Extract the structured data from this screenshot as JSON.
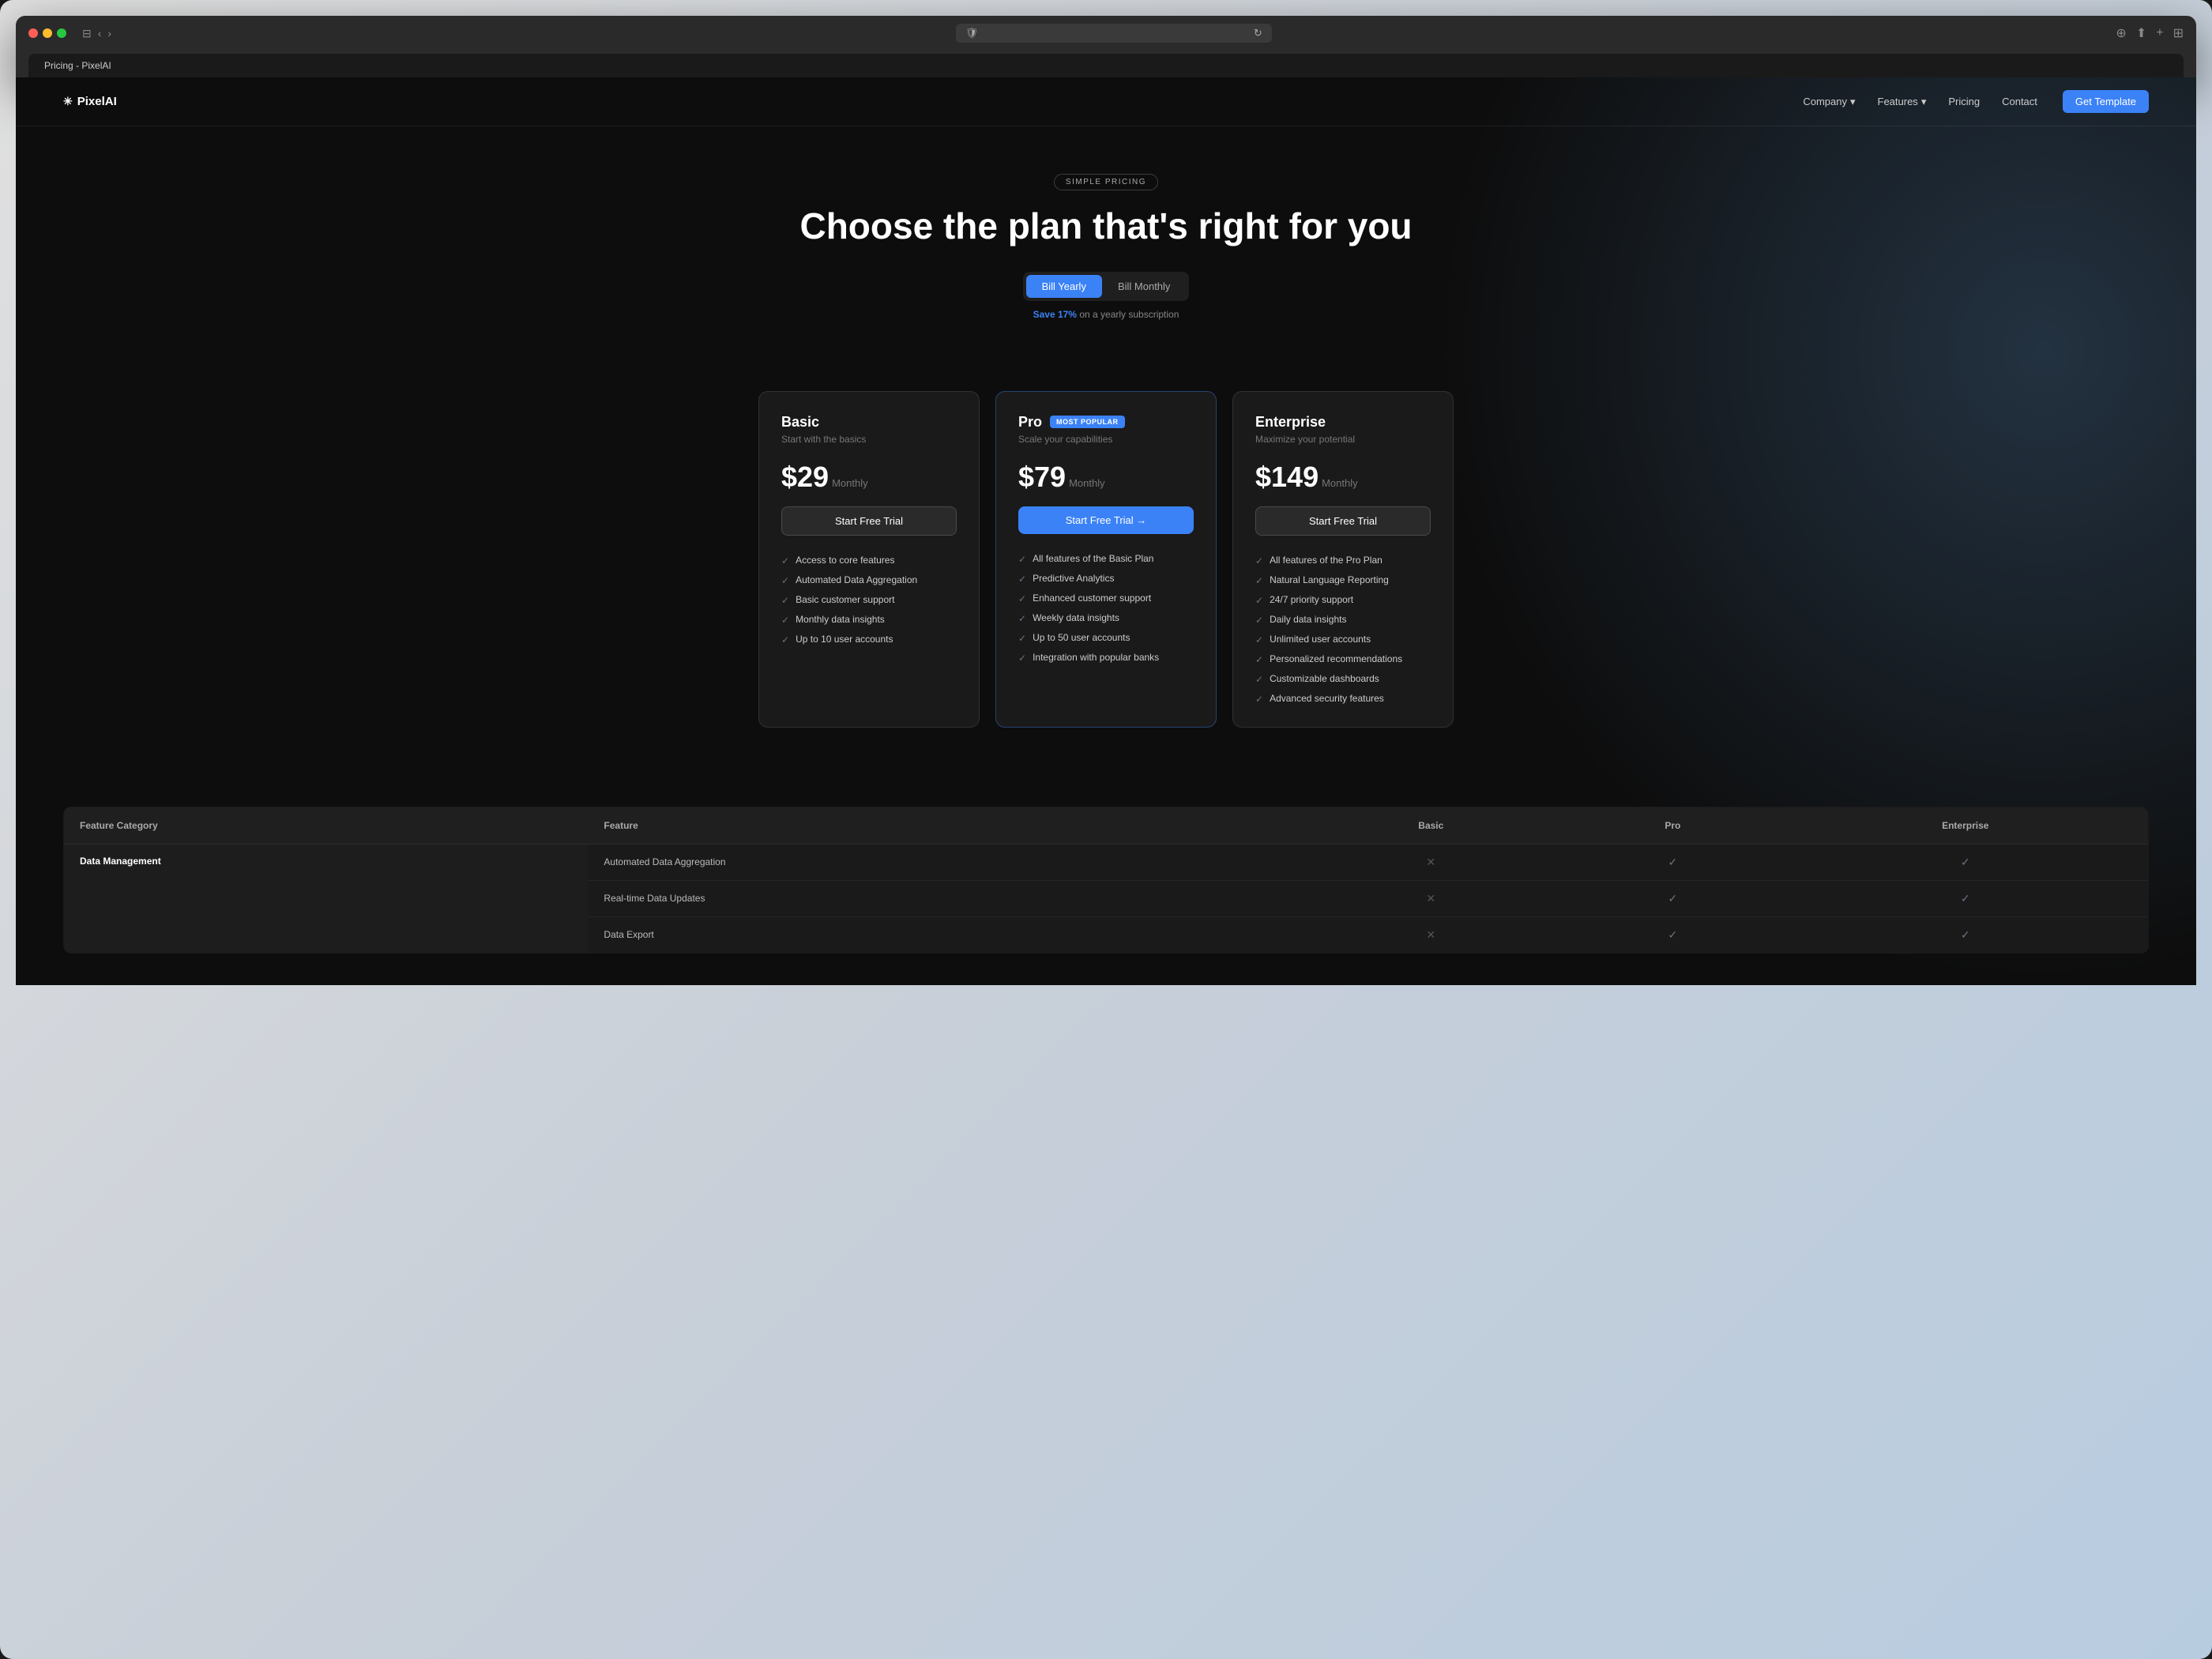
{
  "browser": {
    "tab_title": "Pricing - PixelAI"
  },
  "nav": {
    "logo": "PixelAI",
    "logo_icon": "✳",
    "links": [
      {
        "label": "Company",
        "has_dropdown": true
      },
      {
        "label": "Features",
        "has_dropdown": true
      },
      {
        "label": "Pricing",
        "has_dropdown": false
      },
      {
        "label": "Contact",
        "has_dropdown": false
      }
    ],
    "cta_label": "Get Template"
  },
  "hero": {
    "badge": "SIMPLE PRICING",
    "title": "Choose the plan that's right for you",
    "billing_yearly_label": "Bill Yearly",
    "billing_monthly_label": "Bill Monthly",
    "save_text": "Save",
    "save_percent": "17%",
    "save_suffix": "on a yearly subscription"
  },
  "plans": [
    {
      "id": "basic",
      "name": "Basic",
      "subtitle": "Start with the basics",
      "price": "$29",
      "period": "Monthly",
      "cta": "Start Free Trial",
      "featured": false,
      "features": [
        "Access to core features",
        "Automated Data Aggregation",
        "Basic customer support",
        "Monthly data insights",
        "Up to 10 user accounts"
      ]
    },
    {
      "id": "pro",
      "name": "Pro",
      "subtitle": "Scale your capabilities",
      "price": "$79",
      "period": "Monthly",
      "cta": "Start Free Trial →",
      "featured": true,
      "badge": "MOST POPULAR",
      "features": [
        "All features of the Basic Plan",
        "Predictive Analytics",
        "Enhanced customer support",
        "Weekly data insights",
        "Up to 50 user accounts",
        "Integration with popular banks"
      ]
    },
    {
      "id": "enterprise",
      "name": "Enterprise",
      "subtitle": "Maximize your potential",
      "price": "$149",
      "period": "Monthly",
      "cta": "Start Free Trial",
      "featured": false,
      "features": [
        "All features of the Pro Plan",
        "Natural Language Reporting",
        "24/7 priority support",
        "Daily data insights",
        "Unlimited user accounts",
        "Personalized recommendations",
        "Customizable dashboards",
        "Advanced security features"
      ]
    }
  ],
  "comparison": {
    "headers": [
      "Feature Category",
      "Feature",
      "Basic",
      "Pro",
      "Enterprise"
    ],
    "rows": [
      {
        "category": "Data Management",
        "features": [
          {
            "name": "Automated Data Aggregation",
            "basic": false,
            "pro": true,
            "enterprise": true
          },
          {
            "name": "Real-time Data Updates",
            "basic": false,
            "pro": true,
            "enterprise": true
          },
          {
            "name": "Data Export",
            "basic": false,
            "pro": true,
            "enterprise": true
          }
        ]
      }
    ]
  }
}
